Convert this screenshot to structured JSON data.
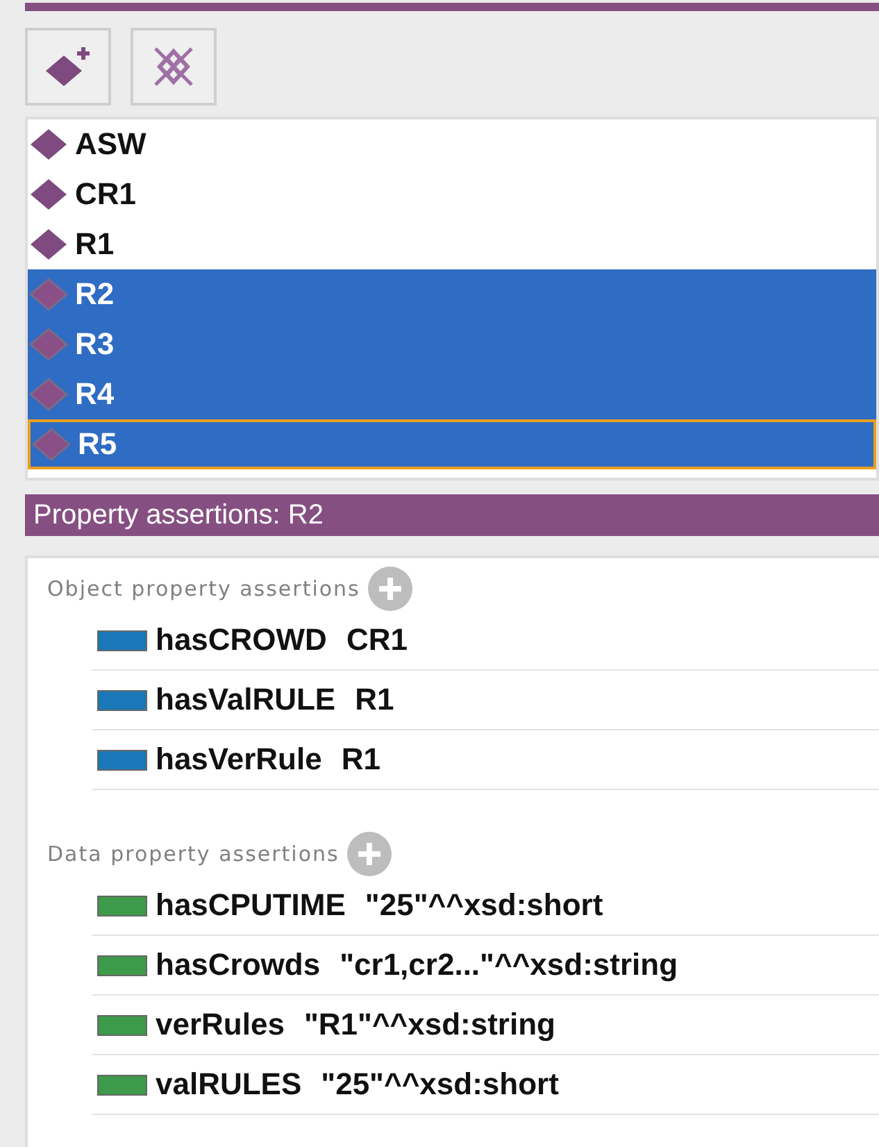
{
  "individuals": [
    {
      "name": "ASW",
      "selected": false,
      "focused": false
    },
    {
      "name": "CR1",
      "selected": false,
      "focused": false
    },
    {
      "name": "R1",
      "selected": false,
      "focused": false
    },
    {
      "name": "R2",
      "selected": true,
      "focused": false
    },
    {
      "name": "R3",
      "selected": true,
      "focused": false
    },
    {
      "name": "R4",
      "selected": true,
      "focused": false
    },
    {
      "name": "R5",
      "selected": true,
      "focused": true
    }
  ],
  "property_panel": {
    "title": "Property assertions: R2",
    "sections": [
      {
        "label": "Object property assertions",
        "kind": "object",
        "rows": [
          {
            "property": "hasCROWD",
            "value": "CR1"
          },
          {
            "property": "hasValRULE",
            "value": "R1"
          },
          {
            "property": "hasVerRule",
            "value": "R1"
          }
        ]
      },
      {
        "label": "Data property assertions",
        "kind": "data",
        "rows": [
          {
            "property": "hasCPUTIME",
            "value": "\"25\"^^xsd:short"
          },
          {
            "property": "hasCrowds",
            "value": "\"cr1,cr2...\"^^xsd:string"
          },
          {
            "property": "verRules",
            "value": "\"R1\"^^xsd:string"
          },
          {
            "property": "valRULES",
            "value": "\"25\"^^xsd:short"
          }
        ]
      }
    ]
  }
}
